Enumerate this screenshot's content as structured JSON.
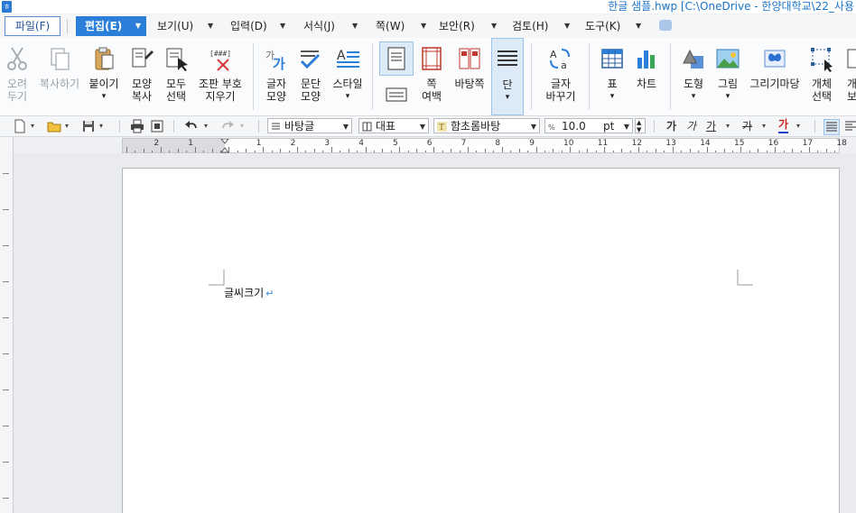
{
  "window": {
    "title": "한글 샘플.hwp [C:\\OneDrive - 한양대학교\\22_사용"
  },
  "menu": {
    "file": "파일(F)",
    "edit": "편집(E)",
    "items": [
      "보기(U)",
      "입력(D)",
      "서식(J)",
      "쪽(W)",
      "보안(R)",
      "검토(H)",
      "도구(K)"
    ]
  },
  "ribbon": {
    "cut": [
      "오려",
      "두기"
    ],
    "copy": "복사하기",
    "paste": "붙이기",
    "copy_format": [
      "모양",
      "복사"
    ],
    "select_all": [
      "모두",
      "선택"
    ],
    "format_code": [
      "조판 부호",
      "지우기"
    ],
    "char_shape": [
      "글자",
      "모양"
    ],
    "para_shape": [
      "문단",
      "모양"
    ],
    "style": "스타일",
    "page_margin": [
      "쪽",
      "여백"
    ],
    "master_page": "바탕쪽",
    "column": "단",
    "replace": [
      "글자",
      "바꾸기"
    ],
    "table": "표",
    "chart": "차트",
    "shape": "도형",
    "picture": "그림",
    "drawing_market": "그리기마당",
    "select_object": [
      "개체",
      "선택"
    ],
    "object_view": [
      "개체",
      "보"
    ]
  },
  "toolbar": {
    "style_value": "바탕글",
    "lang_value": "대표",
    "font_value": "함초롬바탕",
    "size_value": "10.0",
    "size_unit": "pt",
    "fmt_bold": "가",
    "fmt_italic": "가",
    "fmt_underline": "가",
    "fmt_strike": "가",
    "fmt_color": "가"
  },
  "ruler": {
    "h_left": [
      "2",
      "1"
    ],
    "h_right": [
      "1",
      "2",
      "3",
      "4",
      "5",
      "6",
      "7",
      "8",
      "9",
      "10",
      "11",
      "12",
      "13",
      "14",
      "15",
      "16",
      "17",
      "18"
    ]
  },
  "document": {
    "text": "글씨크기",
    "para_mark": "↵"
  },
  "colors": {
    "accent": "#2c7fd8",
    "title_text": "#1a73c8",
    "para_mark": "#3a8ad8"
  }
}
